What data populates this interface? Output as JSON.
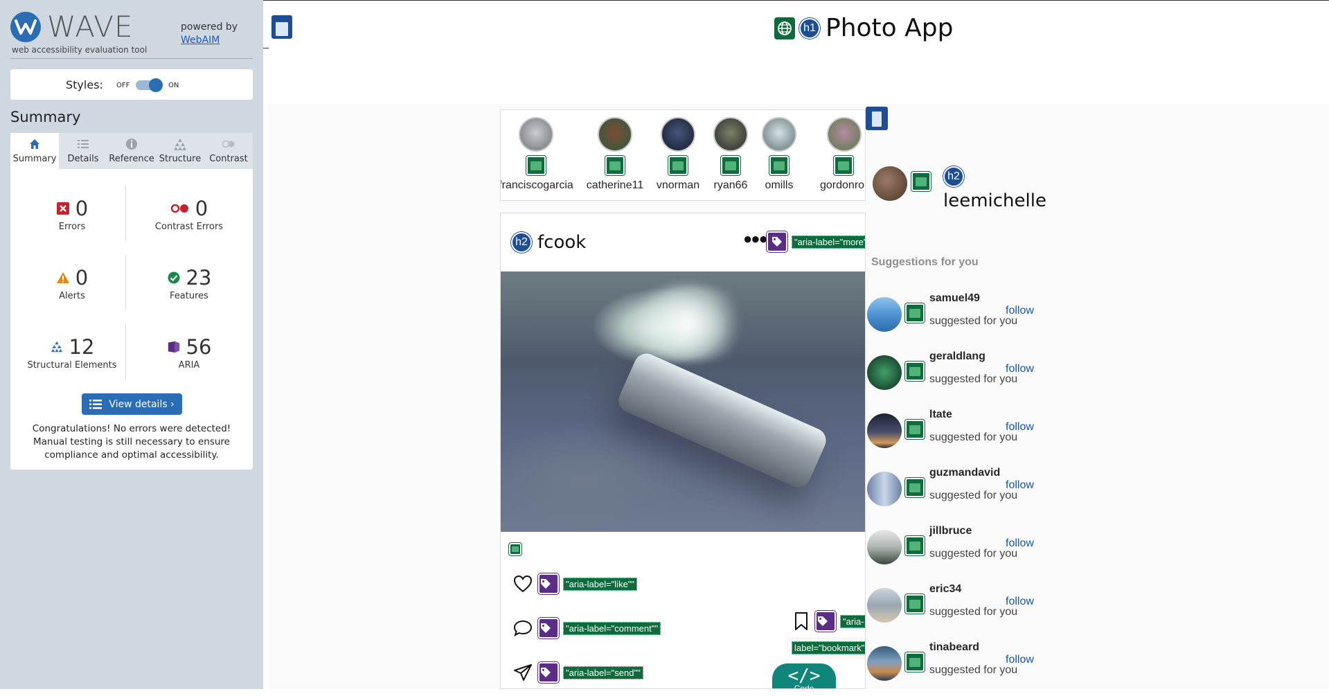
{
  "wave": {
    "logo_text": "WAVE",
    "subtitle": "web accessibility evaluation tool",
    "powered_by": "powered by",
    "webaim_link": "WebAIM",
    "styles_label": "Styles:",
    "styles_off": "OFF",
    "styles_on": "ON",
    "summary_heading": "Summary",
    "tabs": [
      {
        "label": "Summary",
        "icon": "home-icon"
      },
      {
        "label": "Details",
        "icon": "list-icon"
      },
      {
        "label": "Reference",
        "icon": "info-icon"
      },
      {
        "label": "Structure",
        "icon": "hierarchy-icon"
      },
      {
        "label": "Contrast",
        "icon": "contrast-icon"
      }
    ],
    "stats": {
      "errors": {
        "value": "0",
        "label": "Errors"
      },
      "contrast_errors": {
        "value": "0",
        "label": "Contrast Errors"
      },
      "alerts": {
        "value": "0",
        "label": "Alerts"
      },
      "features": {
        "value": "23",
        "label": "Features"
      },
      "structural": {
        "value": "12",
        "label": "Structural Elements"
      },
      "aria": {
        "value": "56",
        "label": "ARIA"
      }
    },
    "view_details": "View details ›",
    "congrats": "Congratulations! No errors were detected! Manual testing is still necessary to ensure compliance and optimal accessibility."
  },
  "app": {
    "title": "Photo App",
    "h1_badge": "h1",
    "h2_badge": "h2",
    "stories": [
      {
        "name": "franciscogarcia",
        "color": "#8f9396"
      },
      {
        "name": "catherine11",
        "color": "#5c7a5a"
      },
      {
        "name": "vnorman",
        "color": "#2f3a55"
      },
      {
        "name": "ryan66",
        "color": "#4d5248"
      },
      {
        "name": "omills",
        "color": "#9fb2b5"
      },
      {
        "name": "gordonro",
        "color": "#8a6a7a"
      }
    ],
    "post": {
      "username": "fcook",
      "more_aria": "\"aria-label=\"more\"",
      "like_aria": "\"aria-label=\"like\"\"",
      "comment_aria": "\"aria-label=\"comment\"\"",
      "send_aria": "\"aria-label=\"send\"\"",
      "bookmark_aria_1": "\"aria-",
      "bookmark_aria_2": "label=\"bookmark\"",
      "code_label": "Code",
      "code_glyph": "</>"
    },
    "me": {
      "username": "leemichelle"
    },
    "suggestions_heading": "Suggestions for you",
    "suggestions": [
      {
        "name": "samuel49",
        "sub": "suggested for you",
        "follow": "follow",
        "color": "#4a8fcf"
      },
      {
        "name": "geraldlang",
        "sub": "suggested for you",
        "follow": "follow",
        "color": "#1f5a3e"
      },
      {
        "name": "ltate",
        "sub": "suggested for you",
        "follow": "follow",
        "color": "#2e2f45"
      },
      {
        "name": "guzmandavid",
        "sub": "suggested for you",
        "follow": "follow",
        "color": "#7b8fb3"
      },
      {
        "name": "jillbruce",
        "sub": "suggested for you",
        "follow": "follow",
        "color": "#5a6a5e"
      },
      {
        "name": "eric34",
        "sub": "suggested for you",
        "follow": "follow",
        "color": "#a7b3bf"
      },
      {
        "name": "tinabeard",
        "sub": "suggested for you",
        "follow": "follow",
        "color": "#3b5a7d"
      }
    ]
  },
  "colors": {
    "wave_blue": "#2a6db5",
    "aria_purple": "#5b2d86",
    "alt_green": "#0f6b3b",
    "follow_link": "#1557a6"
  }
}
